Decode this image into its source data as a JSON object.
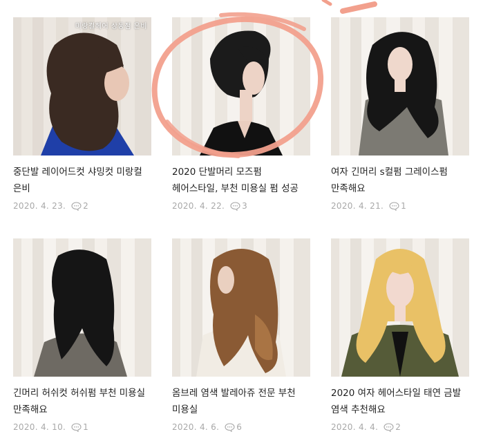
{
  "posts": [
    {
      "title": "중단발 레이어드컷 샤밍컷 미랑컬 은비",
      "date": "2020. 4. 23.",
      "comments": "2",
      "overlay": "미랑컬헤어 상동점 은비"
    },
    {
      "title": "2020 단발머리 모즈펌 헤어스타일, 부천 미용실 펌 성공",
      "date": "2020. 4. 22.",
      "comments": "3"
    },
    {
      "title": "여자 긴머리 s컬펌 그레이스펌 만족해요",
      "date": "2020. 4. 21.",
      "comments": "1"
    },
    {
      "title": "긴머리 허쉬컷 허쉬펌 부천 미용실 만족해요",
      "date": "2020. 4. 10.",
      "comments": "1"
    },
    {
      "title": "옴브레 염색 발레아쥬 전문 부천 미용실",
      "date": "2020. 4. 6.",
      "comments": "6"
    },
    {
      "title": "2020 여자 헤어스타일 태연 금발 염색 추천해요",
      "date": "2020. 4. 4.",
      "comments": "2"
    }
  ],
  "colors": {
    "annotation": "#f2a08d",
    "meta_text": "#a8a8a8",
    "title_text": "#1f1f1f"
  },
  "icons": {
    "comment": "speech-bubble-icon"
  }
}
